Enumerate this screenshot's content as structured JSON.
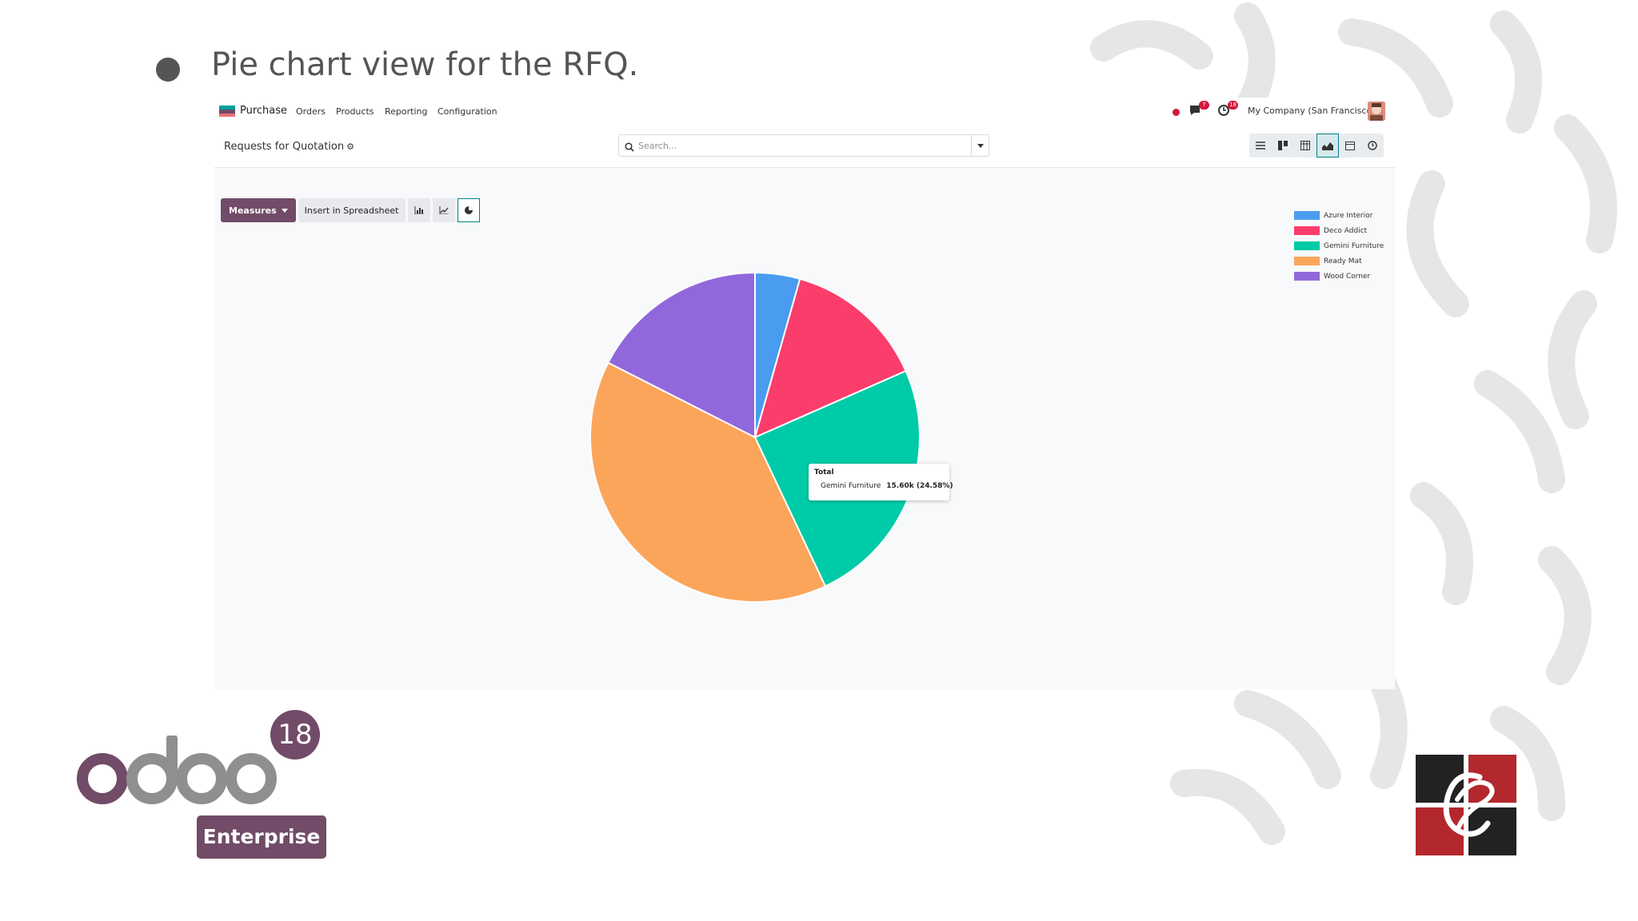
{
  "slide": {
    "heading": "Pie chart view for the RFQ."
  },
  "navbar": {
    "app_name": "Purchase",
    "menu": [
      "Orders",
      "Products",
      "Reporting",
      "Configuration"
    ],
    "messages_badge": "7",
    "activities_badge": "18",
    "company": "My Company (San Francisco)"
  },
  "control_panel": {
    "breadcrumb": "Requests for Quotation",
    "search_placeholder": "Search..."
  },
  "graph_toolbar": {
    "measures_label": "Measures",
    "spreadsheet_label": "Insert in Spreadsheet"
  },
  "tooltip": {
    "title": "Total",
    "label": "Gemini Furniture",
    "value": "15.60k (24.58%)"
  },
  "chart_data": {
    "type": "pie",
    "categories": [
      "Azure Interior",
      "Deco Addict",
      "Gemini Furniture",
      "Ready Mat",
      "Wood Corner"
    ],
    "values": [
      4.4,
      14.0,
      24.58,
      39.5,
      17.52
    ],
    "colors": [
      "#4a9cf0",
      "#fb3d6b",
      "#00cba8",
      "#fba55a",
      "#9168dc"
    ],
    "legend_position": "top-right"
  },
  "logos": {
    "version": "18",
    "edition": "Enterprise",
    "wordmark": "odoo"
  }
}
